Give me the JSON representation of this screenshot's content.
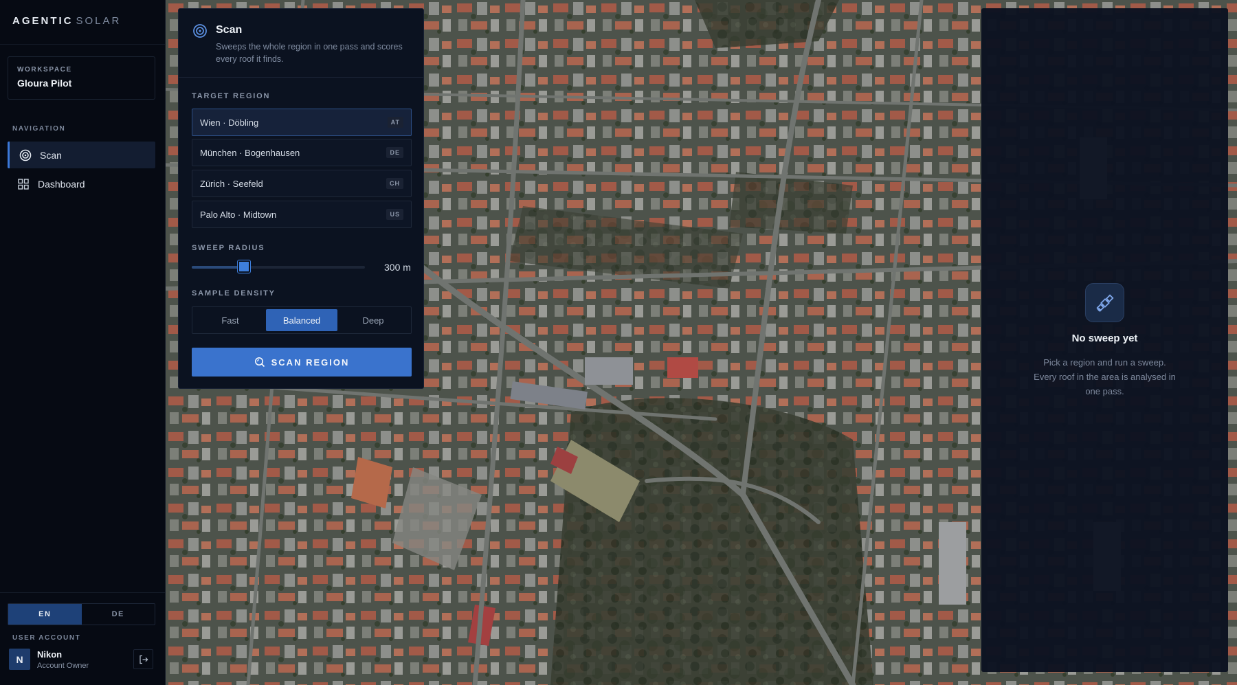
{
  "brand": {
    "primary": "AGENTIC",
    "secondary": "SOLAR"
  },
  "workspace": {
    "label": "WORKSPACE",
    "name": "Gloura Pilot"
  },
  "navigation": {
    "label": "NAVIGATION",
    "items": [
      {
        "label": "Scan",
        "icon": "target-icon",
        "active": true
      },
      {
        "label": "Dashboard",
        "icon": "grid-icon",
        "active": false
      }
    ]
  },
  "language": {
    "options": [
      "EN",
      "DE"
    ],
    "selected": "EN"
  },
  "user": {
    "section_label": "USER ACCOUNT",
    "initial": "N",
    "name": "Nikon",
    "role": "Account Owner"
  },
  "scan_panel": {
    "title": "Scan",
    "description": "Sweeps the whole region in one pass and scores every roof it finds.",
    "target_region_label": "TARGET REGION",
    "regions": [
      {
        "name": "Wien · Döbling",
        "code": "AT",
        "selected": true
      },
      {
        "name": "München · Bogenhausen",
        "code": "DE",
        "selected": false
      },
      {
        "name": "Zürich · Seefeld",
        "code": "CH",
        "selected": false
      },
      {
        "name": "Palo Alto · Midtown",
        "code": "US",
        "selected": false
      }
    ],
    "sweep_radius_label": "SWEEP RADIUS",
    "sweep_radius_value": "300 m",
    "sweep_radius_fraction": 0.3,
    "sample_density_label": "SAMPLE DENSITY",
    "density_options": [
      "Fast",
      "Balanced",
      "Deep"
    ],
    "density_selected": "Balanced",
    "scan_button": "SCAN REGION"
  },
  "result_panel": {
    "title": "No sweep yet",
    "description": "Pick a region and run a sweep. Every roof in the area is analysed in one pass."
  },
  "colors": {
    "accent": "#3a73cd",
    "sidebar_bg": "#060a13",
    "panel_bg": "#0b1220"
  }
}
